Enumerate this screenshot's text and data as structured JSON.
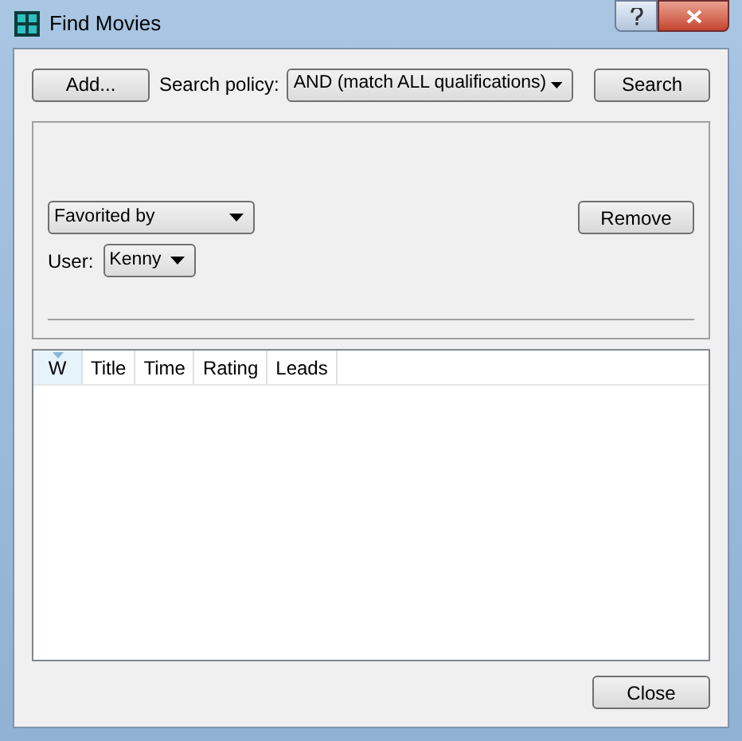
{
  "window": {
    "title": "Find Movies"
  },
  "toolbar": {
    "add_button": "Add...",
    "policy_label": "Search policy:",
    "policy_value": "AND (match ALL qualifications)",
    "search_button": "Search"
  },
  "qualification": {
    "criterion": "Favorited by",
    "remove_button": "Remove",
    "user_label": "User:",
    "user_value": "Kenny"
  },
  "table": {
    "columns": [
      {
        "label": "W",
        "selected": true
      },
      {
        "label": "Title",
        "selected": false
      },
      {
        "label": "Time",
        "selected": false
      },
      {
        "label": "Rating",
        "selected": false
      },
      {
        "label": "Leads",
        "selected": false
      }
    ]
  },
  "close_button": "Close"
}
